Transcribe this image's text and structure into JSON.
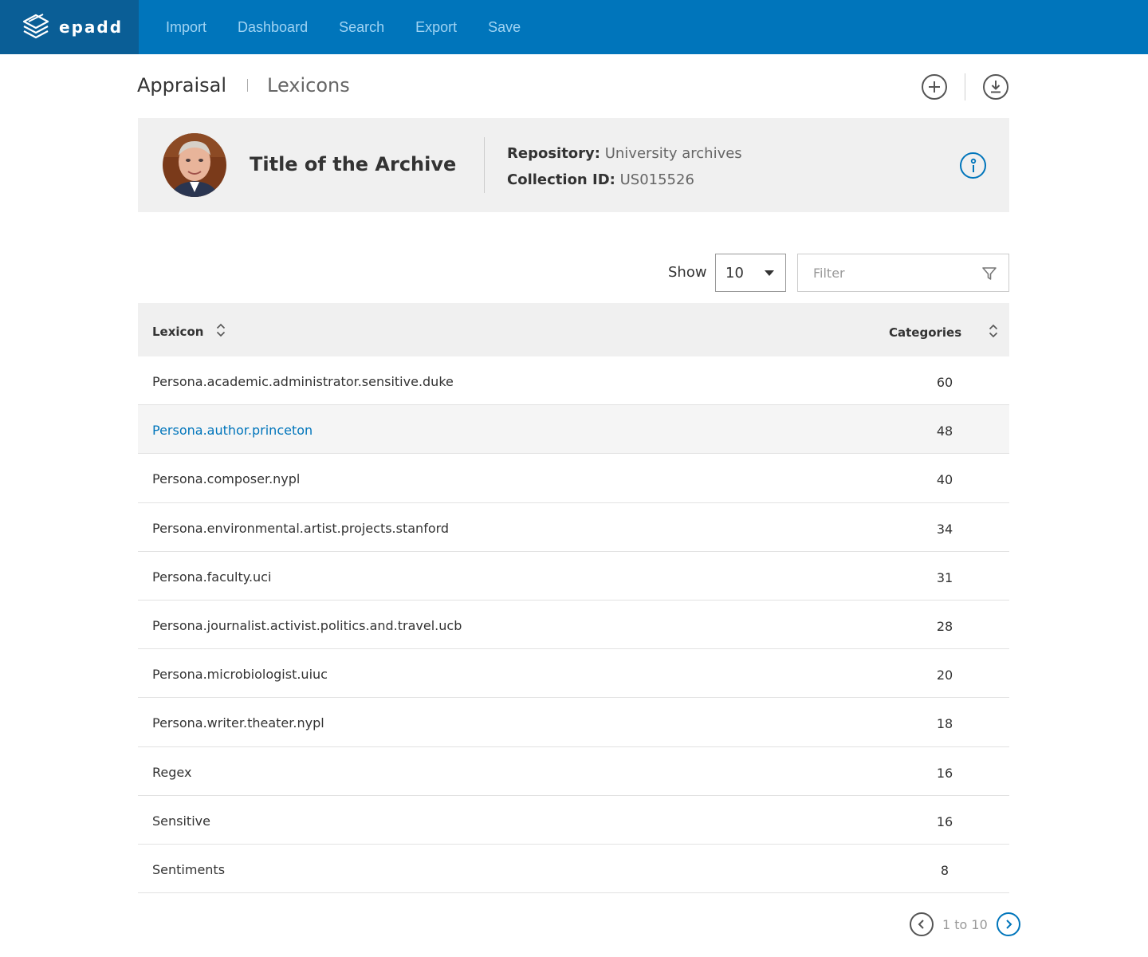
{
  "header": {
    "logo": {
      "text": "epadd",
      "icon": "layers-icon"
    },
    "nav": [
      {
        "label": "Import"
      },
      {
        "label": "Dashboard"
      },
      {
        "label": "Search"
      },
      {
        "label": "Export"
      },
      {
        "label": "Save"
      }
    ],
    "colors": {
      "bar": "#0075bb",
      "logo_box": "#0a5e96",
      "link": "#9fd3f3"
    }
  },
  "breadcrumb": {
    "main": "Appraisal",
    "sub": "Lexicons"
  },
  "actions": {
    "add_icon": "plus-circle-icon",
    "download_icon": "download-circle-icon"
  },
  "archive": {
    "title": "Title of the Archive",
    "repository_label": "Repository:",
    "repository_value": "University archives",
    "collection_label": "Collection ID:",
    "collection_value": "US015526",
    "info_icon": "info-icon"
  },
  "controls": {
    "show_label": "Show",
    "show_value": "10",
    "filter_placeholder": "Filter",
    "filter_icon": "funnel-icon"
  },
  "table": {
    "columns": {
      "lexicon": "Lexicon",
      "categories": "Categories"
    },
    "rows": [
      {
        "name": "Persona.academic.administrator.sensitive.duke",
        "count": "60"
      },
      {
        "name": "Persona.author.princeton",
        "count": "48",
        "highlighted": true
      },
      {
        "name": "Persona.composer.nypl",
        "count": "40"
      },
      {
        "name": "Persona.environmental.artist.projects.stanford",
        "count": "34"
      },
      {
        "name": "Persona.faculty.uci",
        "count": "31"
      },
      {
        "name": "Persona.journalist.activist.politics.and.travel.ucb",
        "count": "28"
      },
      {
        "name": "Persona.microbiologist.uiuc",
        "count": "20"
      },
      {
        "name": "Persona.writer.theater.nypl",
        "count": "18"
      },
      {
        "name": "Regex",
        "count": "16"
      },
      {
        "name": "Sensitive",
        "count": "16"
      },
      {
        "name": "Sentiments",
        "count": "8"
      }
    ]
  },
  "pagination": {
    "text": "1 to 10",
    "accent": "#0075bb"
  }
}
